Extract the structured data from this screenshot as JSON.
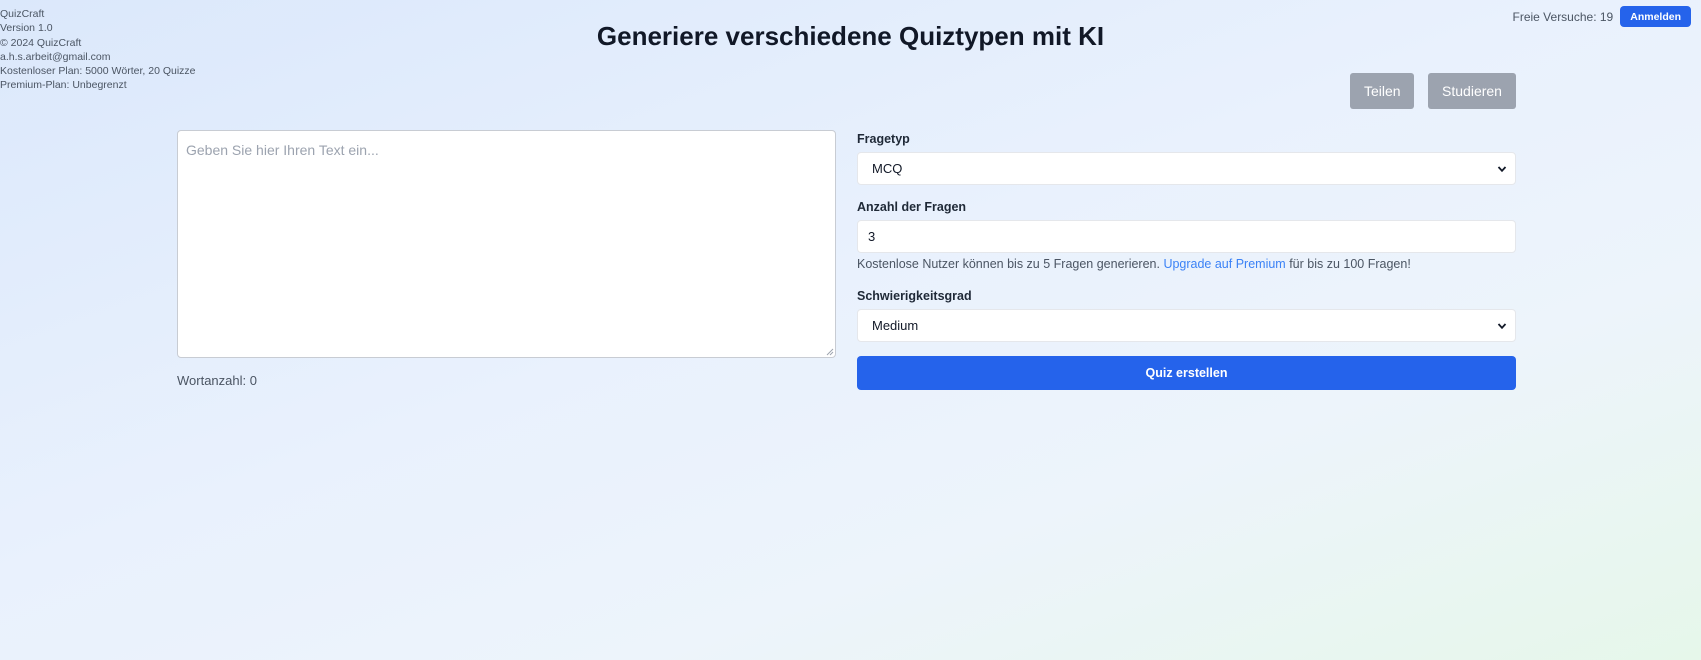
{
  "app_info": {
    "name": "QuizCraft",
    "version": "Version 1.0",
    "copyright": "© 2024 QuizCraft",
    "email": "a.h.s.arbeit@gmail.com",
    "free_plan": "Kostenloser Plan: 5000 Wörter, 20 Quizze",
    "premium_plan": "Premium-Plan: Unbegrenzt"
  },
  "header": {
    "credits_text": "Freie Versuche: 19",
    "login_label": "Anmelden",
    "title": "Generiere verschiedene Quiztypen mit KI"
  },
  "actions": {
    "share_label": "Teilen",
    "study_label": "Studieren"
  },
  "input": {
    "placeholder": "Geben Sie hier Ihren Text ein...",
    "value": "",
    "word_count": "Wortanzahl: 0"
  },
  "form": {
    "question_type_label": "Fragetyp",
    "question_type_value": "MCQ",
    "count_label": "Anzahl der Fragen",
    "count_value": "3",
    "hint_prefix": "Kostenlose Nutzer können bis zu 5 Fragen generieren. ",
    "hint_link": "Upgrade auf Premium",
    "hint_suffix": " für bis zu 100 Fragen!",
    "difficulty_label": "Schwierigkeitsgrad",
    "difficulty_value": "Medium",
    "submit_label": "Quiz erstellen"
  },
  "icons": {
    "select_chevron": "chevron-down-icon",
    "resize": "resize-grip-icon"
  },
  "colors": {
    "primary": "#2563eb",
    "secondary_button": "#9ca3af",
    "link": "#3b82f6"
  }
}
